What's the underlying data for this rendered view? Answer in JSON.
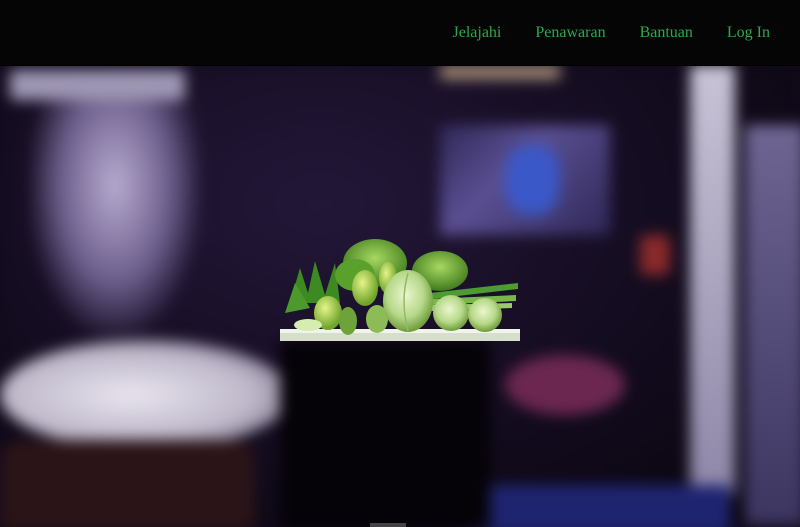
{
  "nav": {
    "items": [
      {
        "label": "Jelajahi"
      },
      {
        "label": "Penawaran"
      },
      {
        "label": "Bantuan"
      },
      {
        "label": "Log In"
      }
    ],
    "link_color": "#2ea84a",
    "background": "#050505"
  },
  "hero": {
    "product_image": "fresh-vegetables"
  }
}
